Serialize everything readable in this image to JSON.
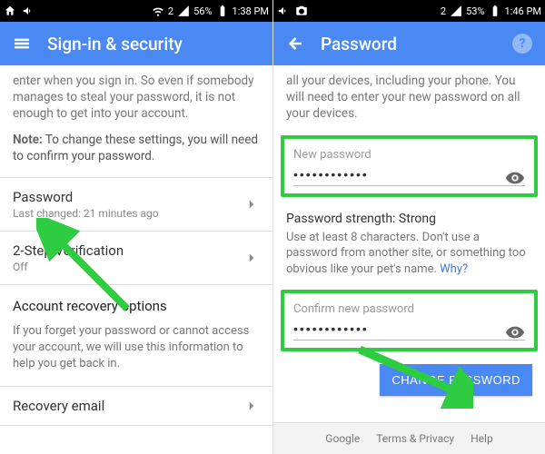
{
  "left": {
    "status": {
      "battery": "56%",
      "time": "1:38 PM",
      "sim": "2"
    },
    "appbar": {
      "title": "Sign-in & security"
    },
    "body_para": "enter when you sign in. So even if somebody manages to steal your password, it is not enough to get into your account.",
    "note_label": "Note:",
    "note_text": " To change these settings, you will need to confirm your password.",
    "items": [
      {
        "title": "Password",
        "sub": "Last changed: 21 minutes ago"
      },
      {
        "title": "2-Step Verification",
        "sub": "Off"
      }
    ],
    "recovery_header": "Account recovery options",
    "recovery_text": "If you forget your password or cannot access your account, we will use this information to help you get back in.",
    "recovery_item": "Recovery email"
  },
  "right": {
    "status": {
      "battery": "53%",
      "time": "1:46 PM",
      "sim": "2"
    },
    "appbar": {
      "title": "Password"
    },
    "intro": "all your devices, including your phone. You will need to enter your new password on all your devices.",
    "new_label": "New password",
    "new_value": "••••••••••••",
    "strength_label": "Password strength:",
    "strength_value": "Strong",
    "hint": "Use at least 8 characters. Don't use a password from another site, or something too obvious like your pet's name. ",
    "hint_link": "Why?",
    "confirm_label": "Confirm new password",
    "confirm_value": "••••••••••••",
    "button": "CHANGE PASSWORD",
    "footer": {
      "a": "Google",
      "b": "Terms & Privacy",
      "c": "Help"
    }
  }
}
